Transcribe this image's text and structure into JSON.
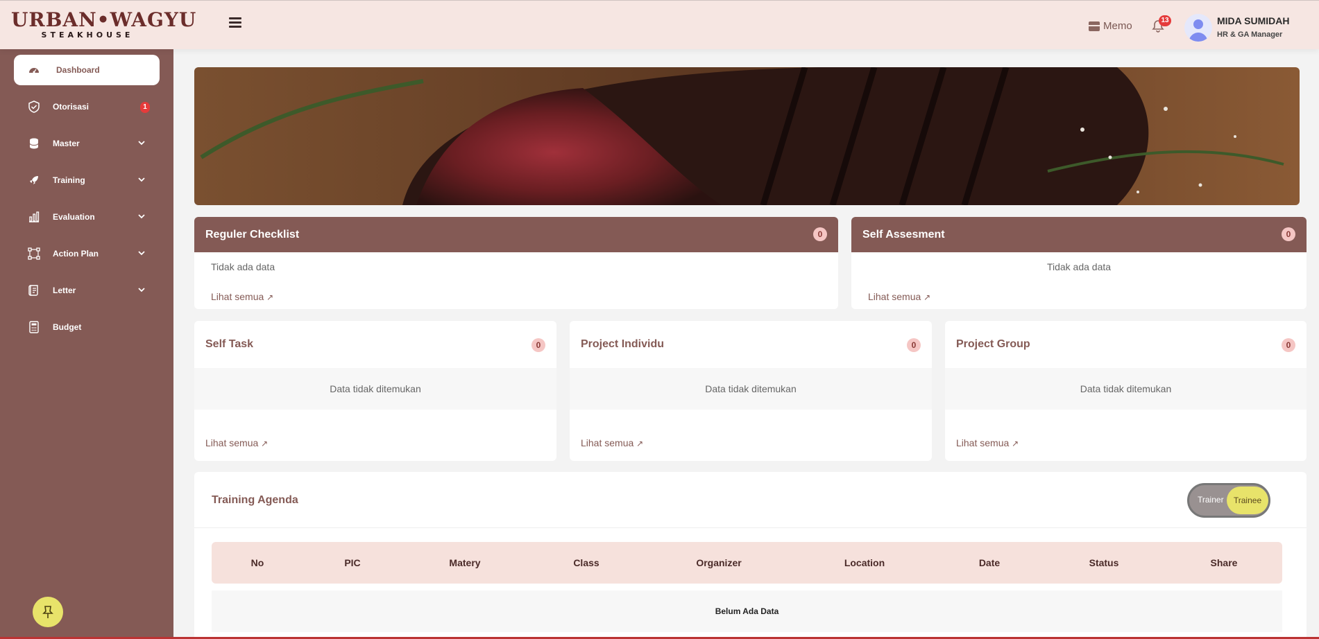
{
  "brand": {
    "line1": "URBAN•WAGYU",
    "line2": "STEAKHOUSE"
  },
  "header": {
    "memo_label": "Memo",
    "notification_count": "13",
    "user_name": "MIDA SUMIDAH",
    "user_role": "HR & GA Manager"
  },
  "sidebar": {
    "items": [
      {
        "label": "Dashboard",
        "icon": "speedometer-icon",
        "active": true
      },
      {
        "label": "Otorisasi",
        "icon": "shield-check-icon",
        "badge": "1"
      },
      {
        "label": "Master",
        "icon": "database-icon",
        "expandable": true
      },
      {
        "label": "Training",
        "icon": "rocket-icon",
        "expandable": true
      },
      {
        "label": "Evaluation",
        "icon": "bar-chart-icon",
        "expandable": true
      },
      {
        "label": "Action Plan",
        "icon": "workflow-icon",
        "expandable": true
      },
      {
        "label": "Letter",
        "icon": "scroll-icon",
        "expandable": true
      },
      {
        "label": "Budget",
        "icon": "calculator-icon"
      }
    ]
  },
  "cards_top": [
    {
      "title": "Reguler Checklist",
      "count": "0",
      "empty_text": "Tidak ada data",
      "see_all": "Lihat semua"
    },
    {
      "title": "Self Assesment",
      "count": "0",
      "empty_text": "Tidak ada data",
      "see_all": "Lihat semua"
    }
  ],
  "cards_mid": [
    {
      "title": "Self Task",
      "count": "0",
      "empty_text": "Data tidak ditemukan",
      "see_all": "Lihat semua"
    },
    {
      "title": "Project Individu",
      "count": "0",
      "empty_text": "Data tidak ditemukan",
      "see_all": "Lihat semua"
    },
    {
      "title": "Project Group",
      "count": "0",
      "empty_text": "Data tidak ditemukan",
      "see_all": "Lihat semua"
    }
  ],
  "agenda": {
    "title": "Training Agenda",
    "toggle": {
      "option_a": "Trainer",
      "option_b": "Trainee",
      "selected": "Trainee"
    },
    "columns": [
      "No",
      "PIC",
      "Matery",
      "Class",
      "Organizer",
      "Location",
      "Date",
      "Status",
      "Share"
    ],
    "empty_text": "Belum Ada Data"
  },
  "colors": {
    "primary": "#845a55",
    "header_bg": "#f6e6e2",
    "accent_yellow": "#e8e36a",
    "badge_red": "#e53b3b"
  }
}
